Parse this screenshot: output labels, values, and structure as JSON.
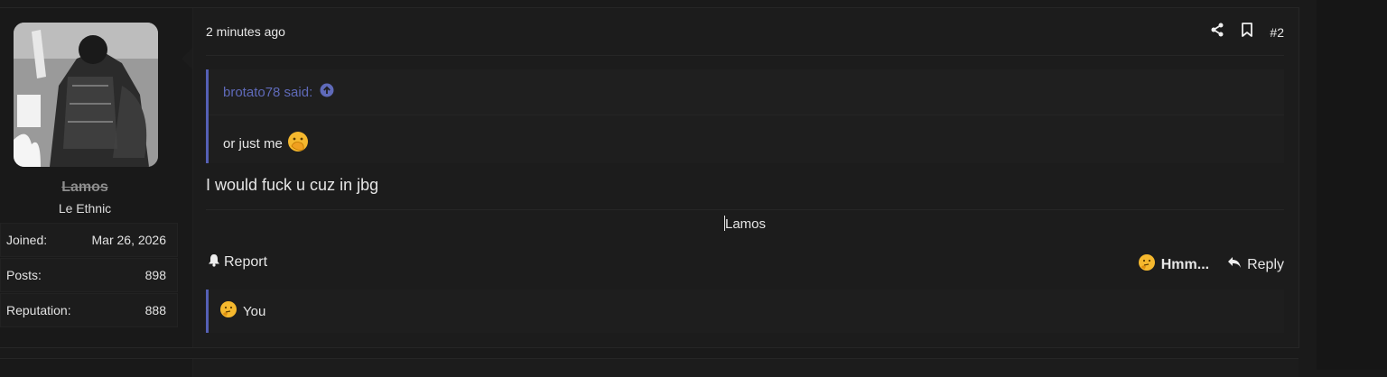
{
  "colors": {
    "accent": "#5560b5",
    "background": "#1a1a1a",
    "card": "#1c1c1c"
  },
  "user": {
    "username": "Lamos",
    "title": "Le Ethnic",
    "stats": [
      {
        "label": "Joined:",
        "value": "Mar 26, 2026"
      },
      {
        "label": "Posts:",
        "value": "898"
      },
      {
        "label": "Reputation:",
        "value": "888"
      }
    ]
  },
  "post": {
    "timestamp": "2 minutes ago",
    "number": "#2",
    "quote": {
      "author_line": "brotato78 said:",
      "text": "or just me",
      "emoji": "hand-over-mouth-emoji"
    },
    "body": "I would fuck u cuz in jbg",
    "signature": "Lamos"
  },
  "actions": {
    "report": "Report",
    "react": "Hmm...",
    "reply": "Reply"
  },
  "reactions": {
    "emoji": "thinking-emoji",
    "users": "You"
  },
  "icons": [
    "share-icon",
    "bookmark-icon",
    "bell-icon",
    "reply-arrow-icon",
    "arrow-up-circle-icon"
  ]
}
